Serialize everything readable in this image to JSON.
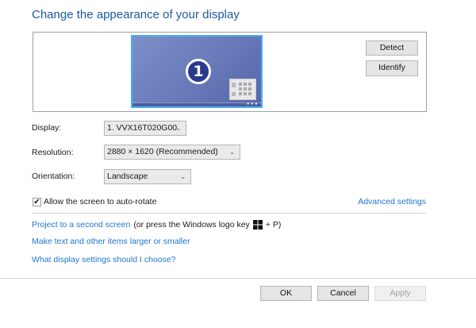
{
  "title": "Change the appearance of your display",
  "preview": {
    "monitor_number": "1",
    "detect": "Detect",
    "identify": "Identify"
  },
  "form": {
    "display_label": "Display:",
    "display_value": "1. VVX16T020G00",
    "resolution_label": "Resolution:",
    "resolution_value": "2880 × 1620 (Recommended)",
    "orientation_label": "Orientation:",
    "orientation_value": "Landscape"
  },
  "auto_rotate": {
    "label": "Allow the screen to auto-rotate",
    "checked": true
  },
  "advanced_settings": "Advanced settings",
  "links": {
    "project": "Project to a second screen",
    "project_hint": "(or press the Windows logo key",
    "project_hint_end": "+ P)",
    "text_size": "Make text and other items larger or smaller",
    "help": "What display settings should I choose?"
  },
  "buttons": {
    "ok": "OK",
    "cancel": "Cancel",
    "apply": "Apply",
    "apply_enabled": false
  },
  "colors": {
    "accent": "#1e5aa0",
    "link": "#1e74d0"
  }
}
